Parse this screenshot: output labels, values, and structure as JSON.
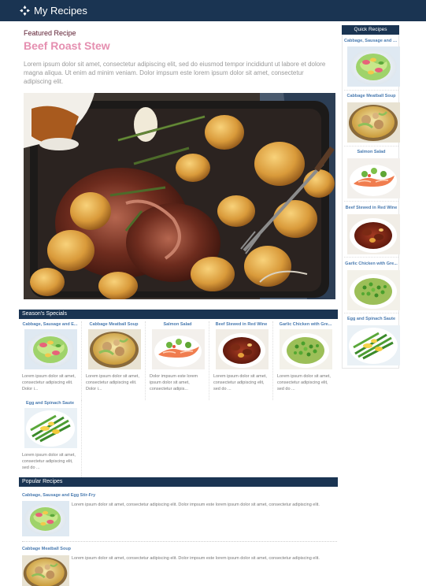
{
  "header": {
    "title": "My Recipes",
    "icon": "app-logo-icon",
    "bg": "#1a3452"
  },
  "featured": {
    "kicker": "Featured Recipe",
    "title": "Beef Roast Stew",
    "description": "Lorem ipsum dolor sit amet, consectetur adipiscing elit, sed do eiusmod tempor incididunt ut labore et dolore magna aliqua. Ut enim ad minim veniam. Dolor impsum este lorem ipsum dolor sit amet, consectetur adipiscing elit.",
    "title_color": "#e58fb0"
  },
  "season": {
    "heading": "Season's Specials",
    "items": [
      {
        "title": "Cabbage, Sausage and E...",
        "text": "Lorem ipsum dolor sit amet, consectetur adipiscing elit. Dolor i..."
      },
      {
        "title": "Cabbage Meatball Soup",
        "text": "Lorem ipsum dolor sit amet, consectetur adipiscing elit. Dolor i..."
      },
      {
        "title": "Salmon Salad",
        "text": "Dolor impsum este lorem ipsum dolor sit amet, consectetur adipis..."
      },
      {
        "title": "Beef Stewed in Red Wine",
        "text": "Lorem ipsum dolor sit amet, consectetur adipiscing elit, sed do ..."
      },
      {
        "title": "Garlic Chicken with Gre...",
        "text": "Lorem ipsum dolor sit amet, consectetur adipiscing elit, sed do ..."
      },
      {
        "title": "Egg and Spinach Saute",
        "text": "Lorem ipsum dolor sit amet, consectetur adipiscing elit, sed do ..."
      }
    ]
  },
  "popular": {
    "heading": "Popular Recipes",
    "items": [
      {
        "title": "Cabbage, Sausage and Egg Stir-Fry",
        "text": "Lorem ipsum dolor sit amet, consectetur adipiscing elit. Dolor impsum este lorem ipsum dolor sit amet, consectetur adipiscing elit."
      },
      {
        "title": "Cabbage Meatball Soup",
        "text": "Lorem ipsum dolor sit amet, consectetur adipiscing elit. Dolor impsum este lorem ipsum dolor sit amet, consectetur adipiscing elit."
      }
    ]
  },
  "quick": {
    "heading": "Quick Recipes",
    "items": [
      {
        "title": "Cabbage, Sausage and E..."
      },
      {
        "title": "Cabbage Meatball Soup"
      },
      {
        "title": "Salmon Salad"
      },
      {
        "title": "Beef Stewed in Red Wine"
      },
      {
        "title": "Garlic Chicken with Gre..."
      },
      {
        "title": "Egg and Spinach Saute"
      }
    ]
  }
}
